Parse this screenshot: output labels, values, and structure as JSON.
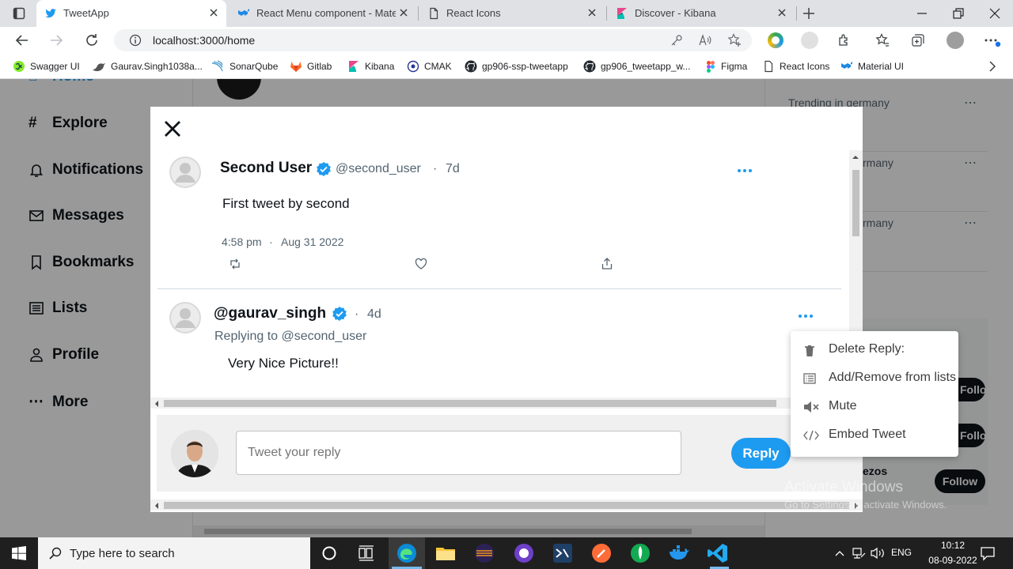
{
  "browser": {
    "tabs": [
      {
        "label": "TweetApp",
        "active": true
      },
      {
        "label": "React Menu component - Mater"
      },
      {
        "label": "React Icons"
      },
      {
        "label": "Discover - Kibana"
      }
    ],
    "url": "localhost:3000/home",
    "bookmarks": [
      "Swagger UI",
      "Gaurav.Singh1038a...",
      "SonarQube",
      "Gitlab",
      "Kibana",
      "CMAK",
      "gp906-ssp-tweetapp",
      "gp906_tweetapp_w...",
      "Figma",
      "React Icons",
      "Material UI"
    ]
  },
  "sidebar": {
    "items": [
      {
        "label": "Home"
      },
      {
        "label": "Explore"
      },
      {
        "label": "Notifications"
      },
      {
        "label": "Messages"
      },
      {
        "label": "Bookmarks"
      },
      {
        "label": "Lists"
      },
      {
        "label": "Profile"
      },
      {
        "label": "More"
      }
    ]
  },
  "right_panel": {
    "trend1": "Trending in germany",
    "trend2": "rmany",
    "trend3": "rmany",
    "follow_buttons": [
      "Follow",
      "Follow",
      "Follow"
    ],
    "partial_name": "ezos"
  },
  "modal": {
    "tweet": {
      "name": "Second User",
      "handle": "@second_user",
      "age": "7d",
      "text": "First tweet by second",
      "time": "4:58 pm",
      "date": "Aug 31 2022"
    },
    "reply": {
      "name": "@gaurav_singh",
      "age": "4d",
      "replying_to": "Replying to @second_user",
      "text": "Very Nice Picture!!"
    },
    "composer": {
      "placeholder": "Tweet your reply",
      "button": "Reply"
    }
  },
  "context_menu": {
    "items": [
      {
        "label": "Delete Reply:",
        "icon": "trash-icon"
      },
      {
        "label": "Add/Remove from lists",
        "icon": "list-icon"
      },
      {
        "label": "Mute",
        "icon": "mute-icon"
      },
      {
        "label": "Embed Tweet",
        "icon": "code-icon"
      }
    ]
  },
  "watermark": {
    "line1": "Activate Windows",
    "line2": "Go to Settings to activate Windows."
  },
  "taskbar": {
    "search_placeholder": "Type here to search",
    "lang": "ENG",
    "time": "10:12",
    "date": "08-09-2022"
  },
  "colors": {
    "accent": "#1d9bf0",
    "verified": "#1d9bf0"
  }
}
